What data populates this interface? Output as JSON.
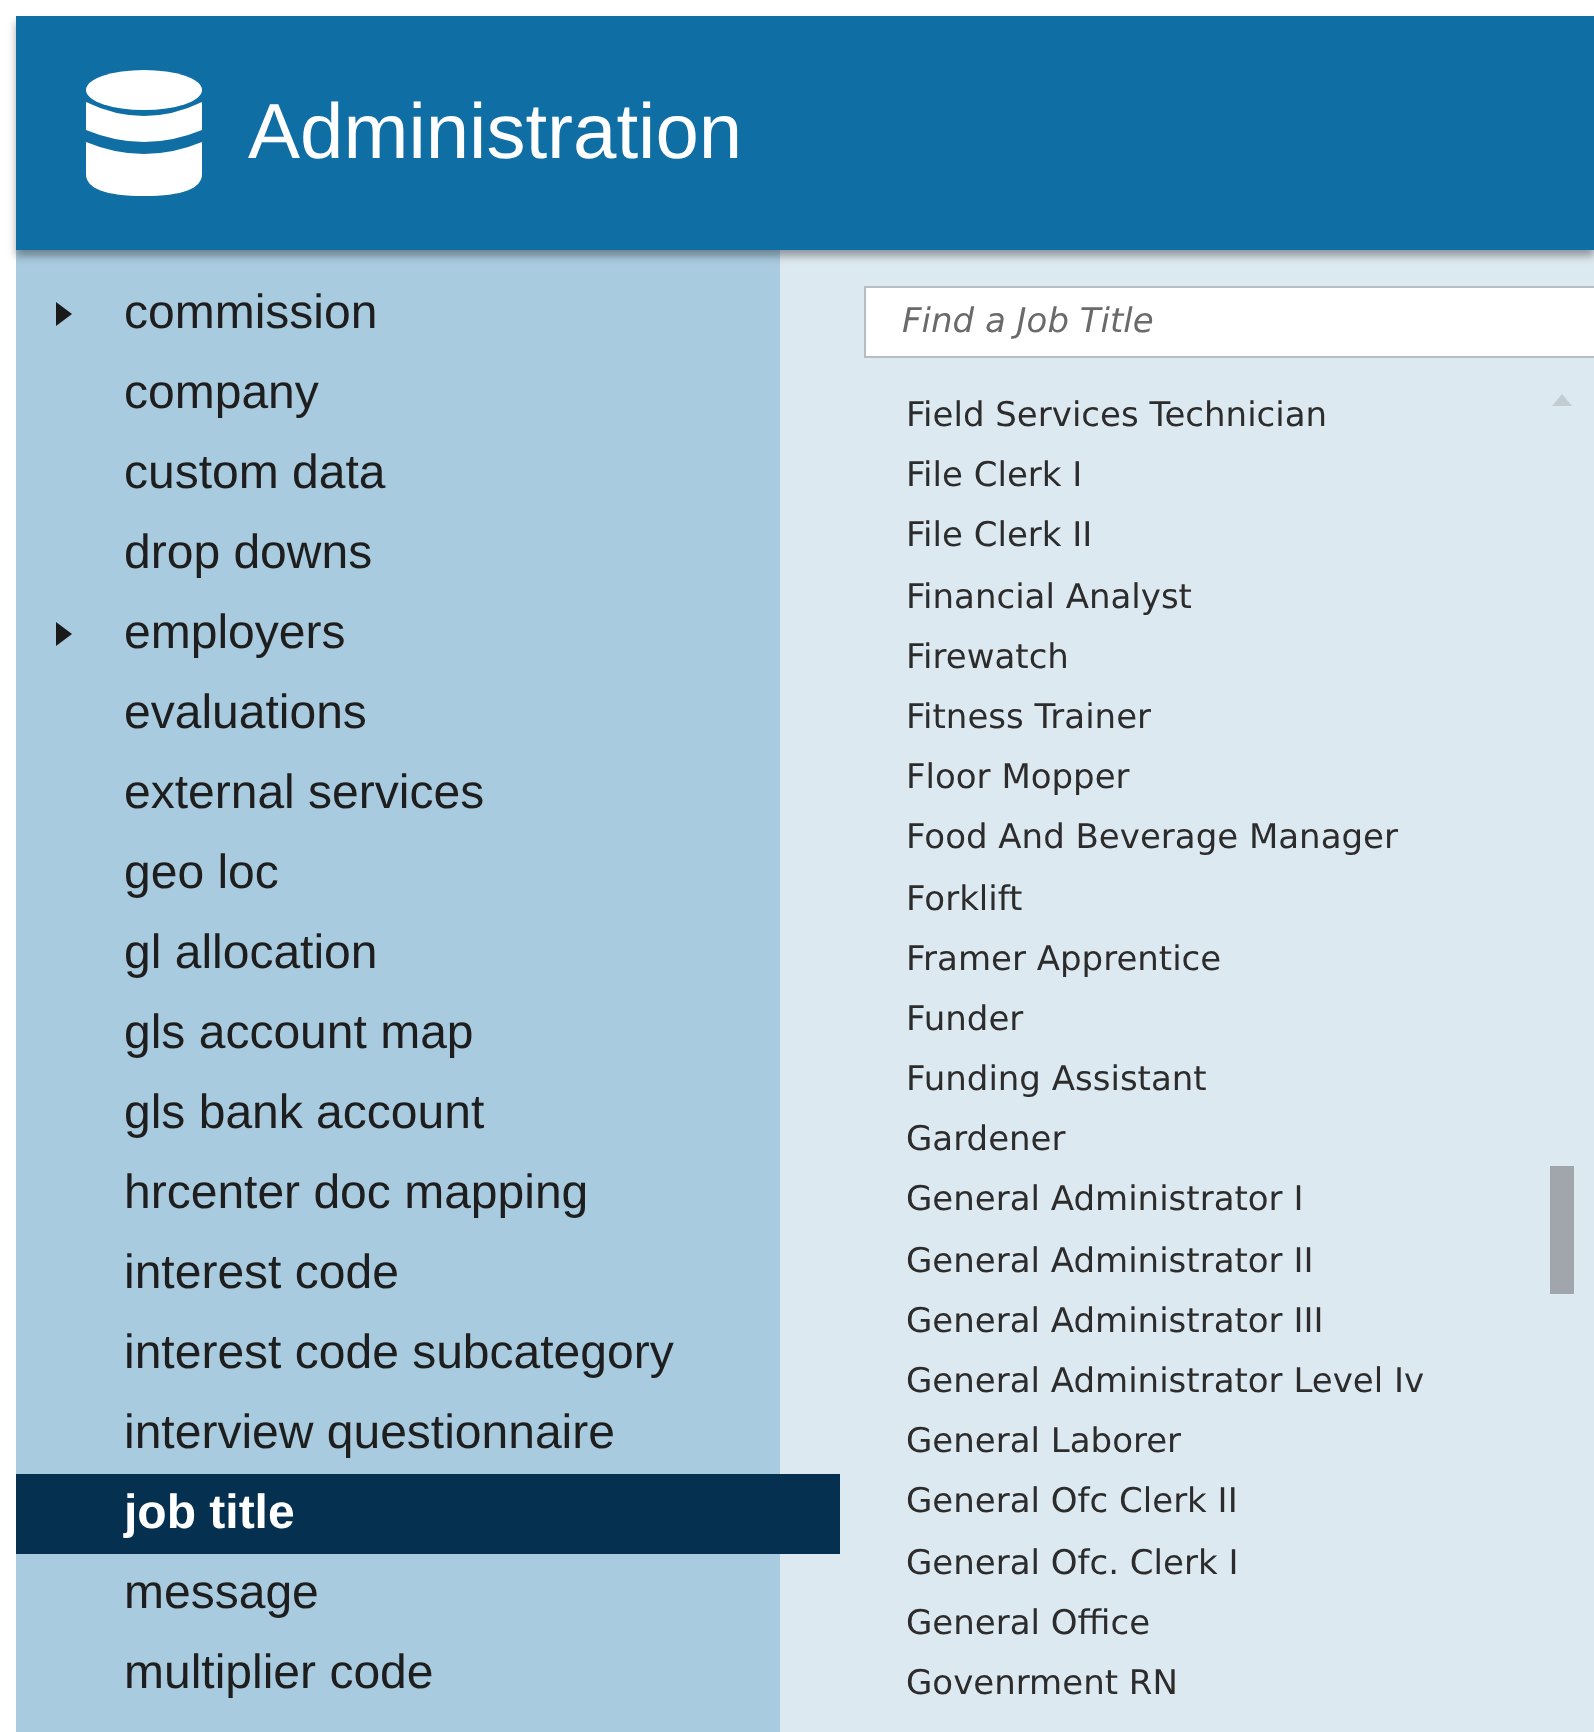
{
  "header": {
    "title": "Administration"
  },
  "sidebar": {
    "items": [
      {
        "label": "commission",
        "expandable": true,
        "selected": false
      },
      {
        "label": "company",
        "expandable": false,
        "selected": false
      },
      {
        "label": "custom data",
        "expandable": false,
        "selected": false
      },
      {
        "label": "drop downs",
        "expandable": false,
        "selected": false
      },
      {
        "label": "employers",
        "expandable": true,
        "selected": false
      },
      {
        "label": "evaluations",
        "expandable": false,
        "selected": false
      },
      {
        "label": "external services",
        "expandable": false,
        "selected": false
      },
      {
        "label": "geo loc",
        "expandable": false,
        "selected": false
      },
      {
        "label": "gl allocation",
        "expandable": false,
        "selected": false
      },
      {
        "label": "gls account map",
        "expandable": false,
        "selected": false
      },
      {
        "label": "gls bank account",
        "expandable": false,
        "selected": false
      },
      {
        "label": "hrcenter doc mapping",
        "expandable": false,
        "selected": false
      },
      {
        "label": "interest code",
        "expandable": false,
        "selected": false
      },
      {
        "label": "interest code subcategory",
        "expandable": false,
        "selected": false
      },
      {
        "label": "interview questionnaire",
        "expandable": false,
        "selected": false
      },
      {
        "label": "job title",
        "expandable": false,
        "selected": true
      },
      {
        "label": "message",
        "expandable": false,
        "selected": false
      },
      {
        "label": "multiplier code",
        "expandable": false,
        "selected": false
      }
    ]
  },
  "search": {
    "placeholder": "Find a Job Title"
  },
  "job_titles": [
    "Field Services Technician",
    "File Clerk I",
    "File Clerk II",
    "Financial Analyst",
    "Firewatch",
    "Fitness Trainer",
    "Floor Mopper",
    "Food And Beverage Manager",
    "Forklift",
    "Framer Apprentice",
    "Funder",
    "Funding Assistant",
    "Gardener",
    "General Administrator I",
    "General Administrator II",
    "General Administrator III",
    "General Administrator Level Iv",
    "General Laborer",
    "General Ofc Clerk II",
    "General Ofc. Clerk I",
    "General Office",
    "Govenrment RN"
  ]
}
